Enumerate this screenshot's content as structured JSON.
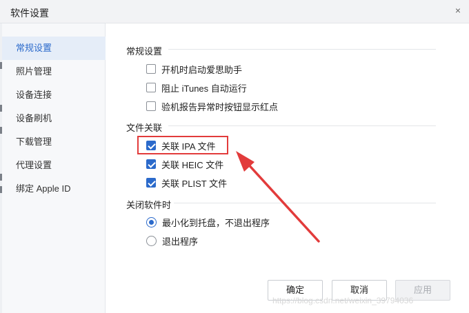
{
  "window": {
    "title": "软件设置",
    "close_glyph": "×"
  },
  "sidebar": {
    "items": [
      {
        "label": "常规设置",
        "active": true
      },
      {
        "label": "照片管理"
      },
      {
        "label": "设备连接"
      },
      {
        "label": "设备刷机"
      },
      {
        "label": "下载管理"
      },
      {
        "label": "代理设置"
      },
      {
        "label": "绑定 Apple ID"
      }
    ]
  },
  "general": {
    "title": "常规设置",
    "options": [
      {
        "label": "开机时启动爱思助手",
        "checked": false
      },
      {
        "label": "阻止 iTunes 自动运行",
        "checked": false
      },
      {
        "label": "验机报告异常时按钮显示红点",
        "checked": false
      }
    ]
  },
  "file_assoc": {
    "title": "文件关联",
    "options": [
      {
        "label": "关联 IPA 文件",
        "checked": true,
        "highlighted": true
      },
      {
        "label": "关联 HEIC 文件",
        "checked": true
      },
      {
        "label": "关联 PLIST 文件",
        "checked": true
      }
    ]
  },
  "on_close": {
    "title": "关闭软件时",
    "options": [
      {
        "label": "最小化到托盘，不退出程序",
        "selected": true
      },
      {
        "label": "退出程序",
        "selected": false
      }
    ]
  },
  "buttons": {
    "ok": "确定",
    "cancel": "取消",
    "apply": "应用"
  },
  "watermark": "https://blog.csdn.net/weixin_39794036",
  "colors": {
    "accent": "#2b6acb",
    "annotation": "#e23b3b"
  }
}
